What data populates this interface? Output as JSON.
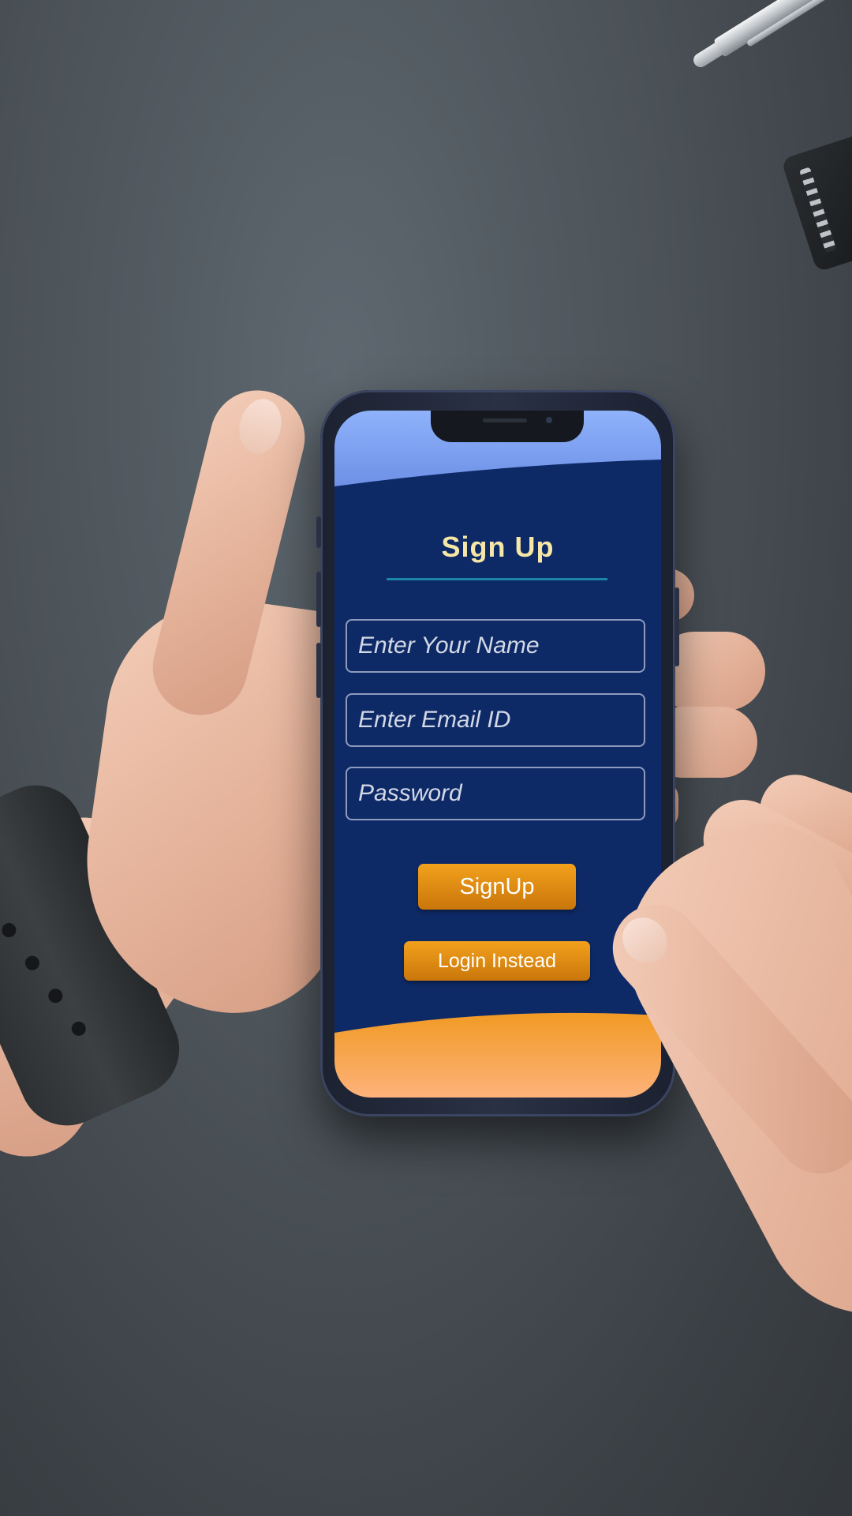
{
  "signup_screen": {
    "title": "Sign Up",
    "fields": {
      "name_placeholder": "Enter Your Name",
      "email_placeholder": "Enter Email ID",
      "password_placeholder": "Password"
    },
    "buttons": {
      "signup_label": "SignUp",
      "login_label": "Login Instead"
    }
  },
  "colors": {
    "screen_background": "#0e2a66",
    "title_text": "#f6e7a6",
    "title_underline": "#1d86a7",
    "top_wave": "#8aaef6",
    "bottom_wave": "#f4a23a",
    "button": "#e58f15",
    "field_border": "#8f9bbd"
  },
  "icons": [
    "front-camera-icon",
    "speaker-grille-icon"
  ]
}
